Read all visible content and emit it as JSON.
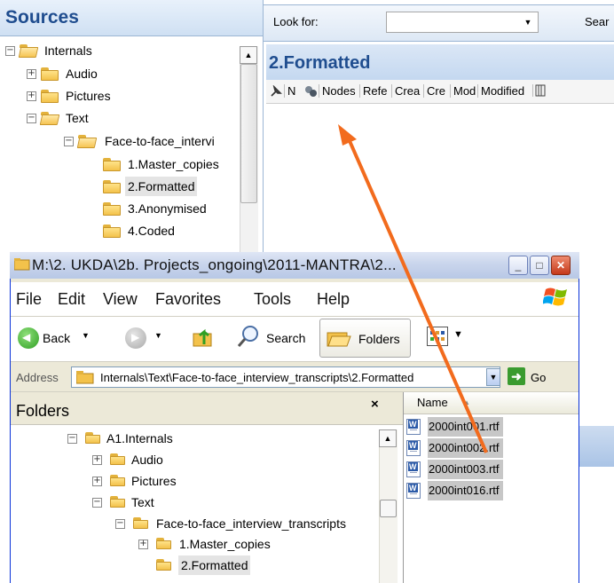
{
  "nvivo": {
    "sources_title": "Sources",
    "tree": [
      {
        "label": "Internals",
        "expander": "−"
      },
      {
        "label": "Audio",
        "expander": "+"
      },
      {
        "label": "Pictures",
        "expander": "+"
      },
      {
        "label": "Text",
        "expander": "−"
      },
      {
        "label": "Face-to-face_intervi",
        "expander": "−"
      },
      {
        "label": "1.Master_copies",
        "expander": ""
      },
      {
        "label": "2.Formatted",
        "expander": "",
        "selected": true
      },
      {
        "label": "3.Anonymised",
        "expander": ""
      },
      {
        "label": "4.Coded",
        "expander": ""
      }
    ],
    "look_for_label": "Look for:",
    "search_label": "Sear",
    "detail_title": "2.Formatted",
    "columns": [
      "N",
      "Nodes",
      "Refe",
      "Crea",
      "Cre",
      "Mod",
      "Modified"
    ]
  },
  "explorer": {
    "title": "M:\\2. UKDA\\2b. Projects_ongoing\\2011-MANTRA\\2...",
    "title_buttons": {
      "minimize": "_",
      "maximize": "□",
      "close": "✕"
    },
    "menu": [
      "File",
      "Edit",
      "View",
      "Favorites",
      "Tools",
      "Help"
    ],
    "toolbar": {
      "back": "Back",
      "search": "Search",
      "folders": "Folders"
    },
    "address_label": "Address",
    "address_value": "Internals\\Text\\Face-to-face_interview_transcripts\\2.Formatted",
    "go_label": "Go",
    "folders_title": "Folders",
    "folders_close": "×",
    "tree": [
      {
        "label": "A1.Internals",
        "expander": "−"
      },
      {
        "label": "Audio",
        "expander": "+"
      },
      {
        "label": "Pictures",
        "expander": "+"
      },
      {
        "label": "Text",
        "expander": "−"
      },
      {
        "label": "Face-to-face_interview_transcripts",
        "expander": "−"
      },
      {
        "label": "1.Master_copies",
        "expander": "+"
      },
      {
        "label": "2.Formatted",
        "expander": "",
        "selected": true
      }
    ],
    "name_header": "Name",
    "files": [
      "2000int001.rtf",
      "2000int002.rtf",
      "2000int003.rtf",
      "2000int016.rtf"
    ]
  },
  "colors": {
    "arrow": "#f26b1d",
    "nvivo_header_text": "#1f4d8f",
    "selection": "#c7c7c7"
  }
}
